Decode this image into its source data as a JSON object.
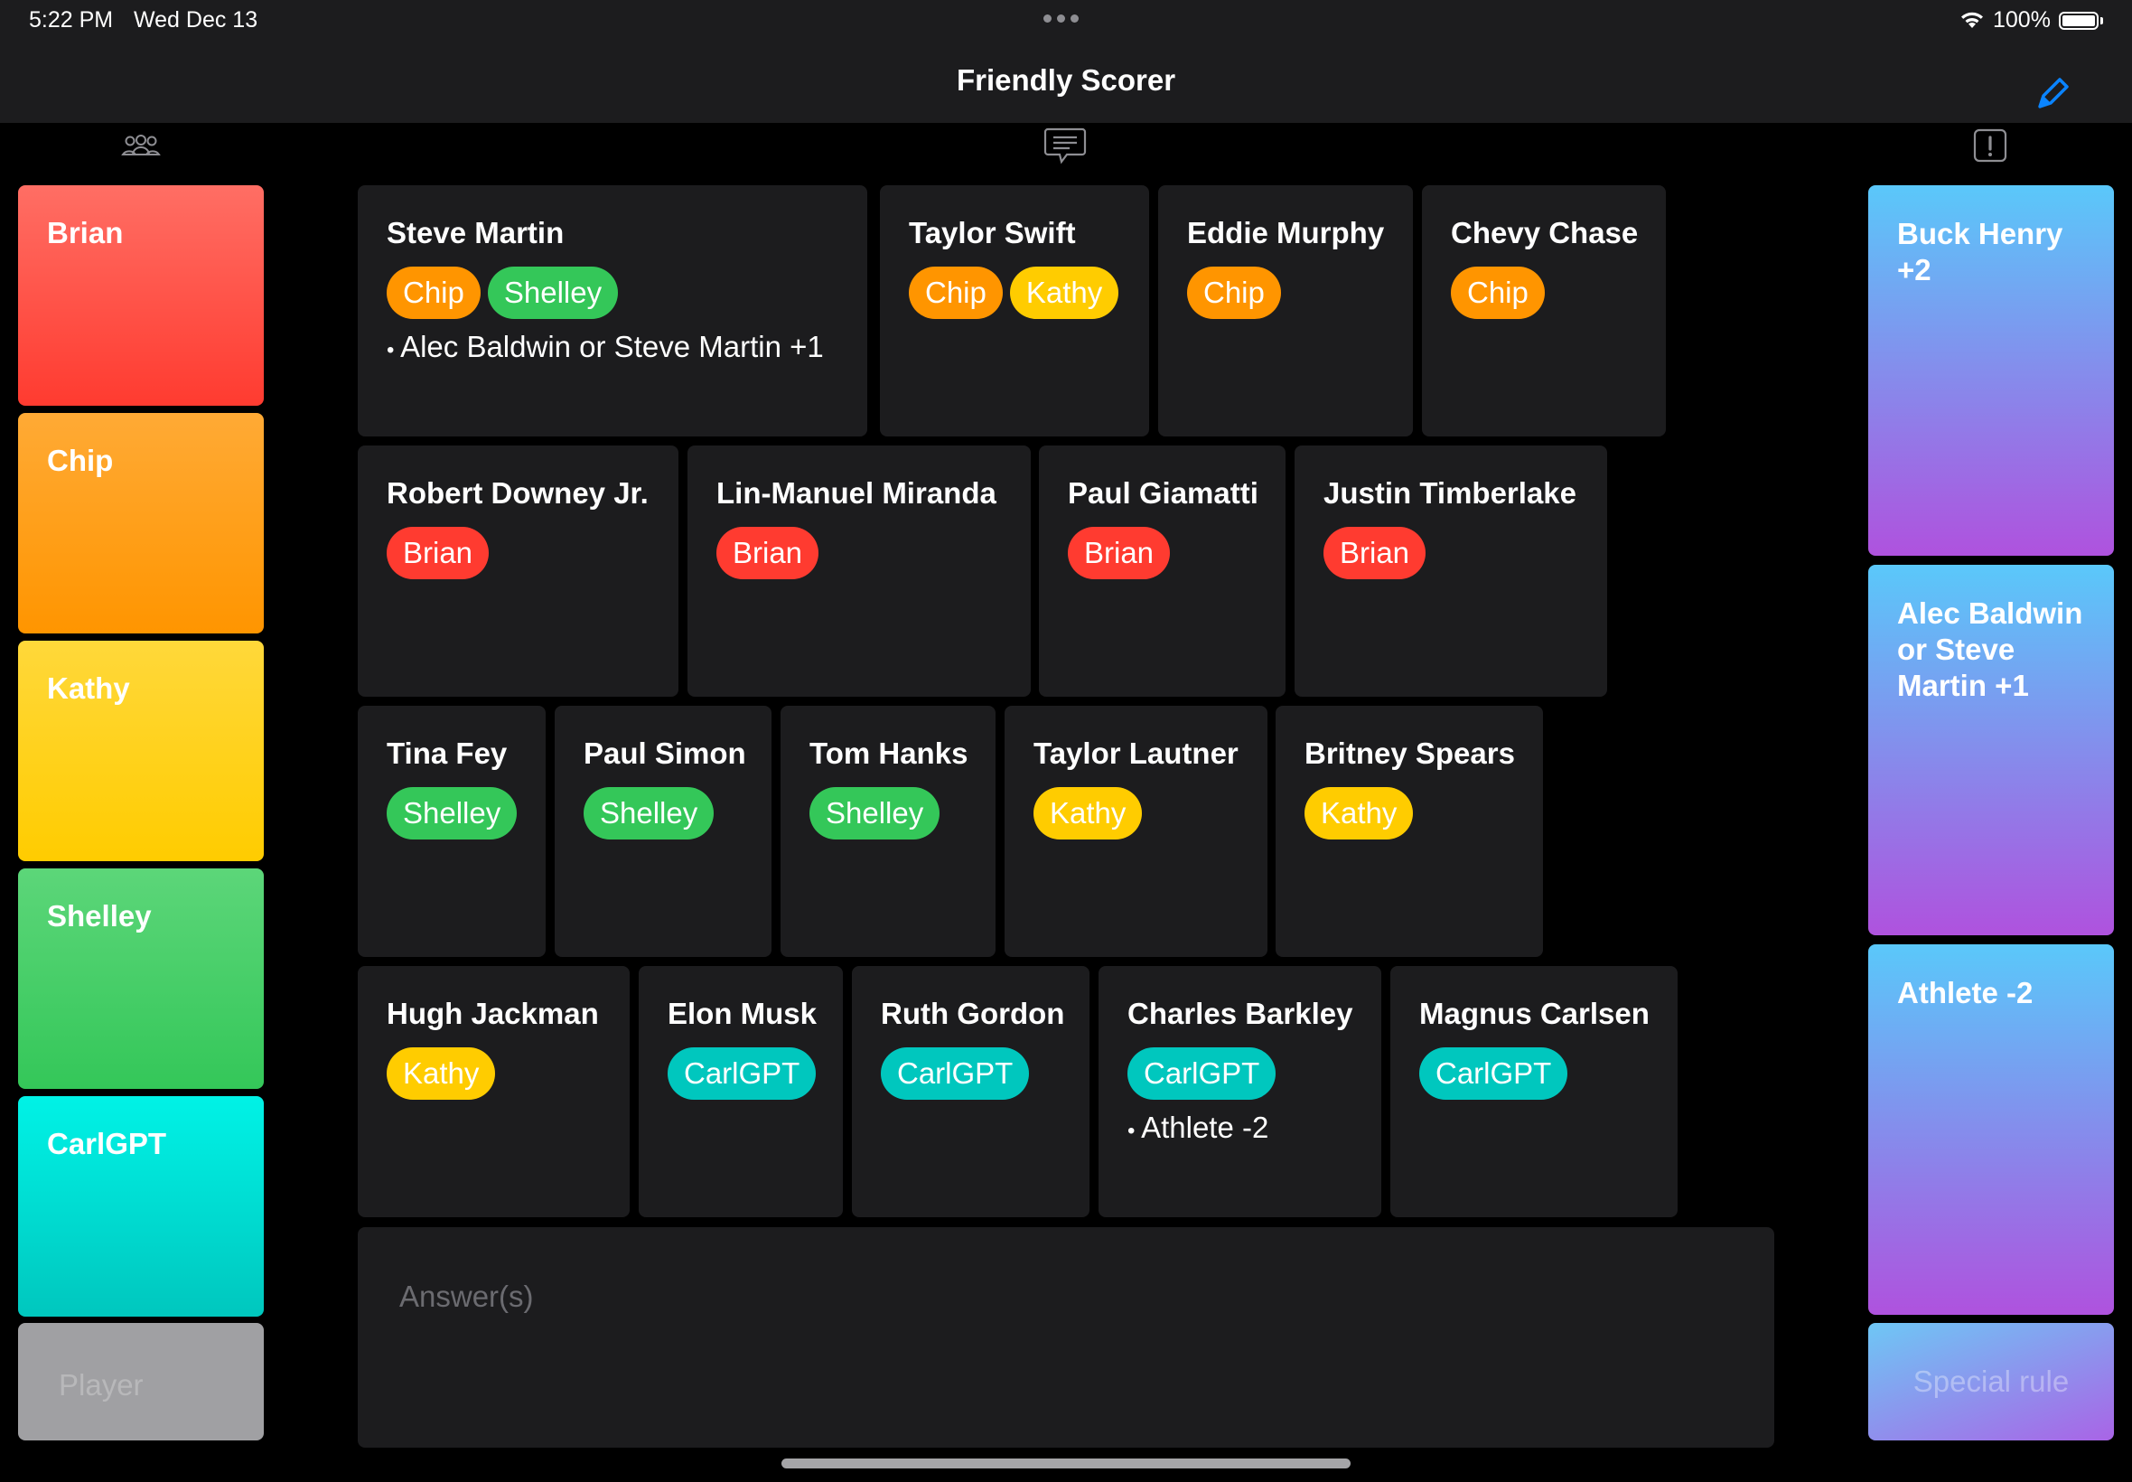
{
  "status_bar": {
    "time": "5:22 PM",
    "date": "Wed Dec 13",
    "battery": "100%"
  },
  "nav": {
    "title": "Friendly Scorer",
    "edit_icon": "pencil-icon"
  },
  "column_icons": {
    "players": "people-icon",
    "answers": "message-icon",
    "rules": "exclamation-icon"
  },
  "colors": {
    "Brian": "#ff3b30",
    "Chip": "#ff9500",
    "Kathy": "#ffcc00",
    "Shelley": "#34c759",
    "CarlGPT": "#00c7be",
    "card": "#1c1c1e",
    "accent": "#0a84ff"
  },
  "players": [
    {
      "name": "Brian"
    },
    {
      "name": "Chip"
    },
    {
      "name": "Kathy"
    },
    {
      "name": "Shelley"
    },
    {
      "name": "CarlGPT"
    }
  ],
  "add_player_placeholder": "Player",
  "answers": [
    {
      "name": "Steve Martin",
      "players": [
        "Chip",
        "Shelley"
      ],
      "notes": [
        "Alec Baldwin or Steve Martin +1"
      ]
    },
    {
      "name": "Taylor Swift",
      "players": [
        "Chip",
        "Kathy"
      ],
      "notes": []
    },
    {
      "name": "Eddie Murphy",
      "players": [
        "Chip"
      ],
      "notes": []
    },
    {
      "name": "Chevy Chase",
      "players": [
        "Chip"
      ],
      "notes": []
    },
    {
      "name": "Robert Downey Jr.",
      "players": [
        "Brian"
      ],
      "notes": []
    },
    {
      "name": "Lin-Manuel Miranda",
      "players": [
        "Brian"
      ],
      "notes": []
    },
    {
      "name": "Paul Giamatti",
      "players": [
        "Brian"
      ],
      "notes": []
    },
    {
      "name": "Justin Timberlake",
      "players": [
        "Brian"
      ],
      "notes": []
    },
    {
      "name": "Tina Fey",
      "players": [
        "Shelley"
      ],
      "notes": []
    },
    {
      "name": "Paul Simon",
      "players": [
        "Shelley"
      ],
      "notes": []
    },
    {
      "name": "Tom Hanks",
      "players": [
        "Shelley"
      ],
      "notes": []
    },
    {
      "name": "Taylor Lautner",
      "players": [
        "Kathy"
      ],
      "notes": []
    },
    {
      "name": "Britney Spears",
      "players": [
        "Kathy"
      ],
      "notes": []
    },
    {
      "name": "Hugh Jackman",
      "players": [
        "Kathy"
      ],
      "notes": []
    },
    {
      "name": "Elon Musk",
      "players": [
        "CarlGPT"
      ],
      "notes": []
    },
    {
      "name": "Ruth Gordon",
      "players": [
        "CarlGPT"
      ],
      "notes": []
    },
    {
      "name": "Charles Barkley",
      "players": [
        "CarlGPT"
      ],
      "notes": [
        "Athlete -2"
      ]
    },
    {
      "name": "Magnus Carlsen",
      "players": [
        "CarlGPT"
      ],
      "notes": []
    }
  ],
  "answer_input": {
    "placeholder": "Answer(s)",
    "value": ""
  },
  "rules": [
    {
      "text": "Buck Henry +2"
    },
    {
      "text": "Alec Baldwin or Steve Martin +1"
    },
    {
      "text": "Athlete -2"
    }
  ],
  "add_rule_placeholder": "Special rule"
}
